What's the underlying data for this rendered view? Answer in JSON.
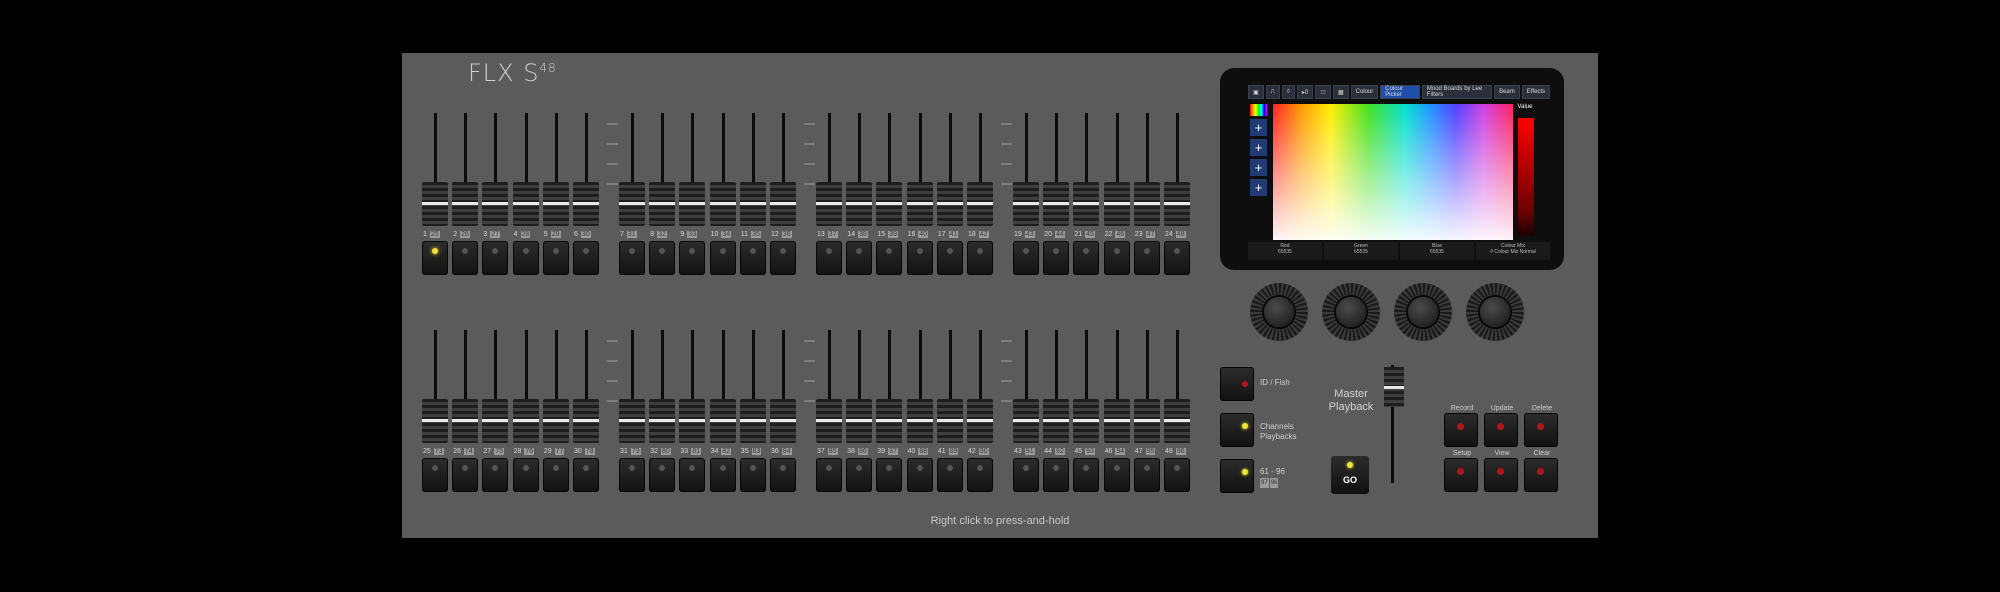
{
  "brand": {
    "name": "FLX S",
    "model_sup": "48"
  },
  "faders_top": [
    {
      "num": "1",
      "pb": "25",
      "led_on": true
    },
    {
      "num": "2",
      "pb": "26"
    },
    {
      "num": "3",
      "pb": "27"
    },
    {
      "num": "4",
      "pb": "28"
    },
    {
      "num": "5",
      "pb": "29"
    },
    {
      "num": "6",
      "pb": "30"
    },
    {
      "num": "7",
      "pb": "31"
    },
    {
      "num": "8",
      "pb": "32"
    },
    {
      "num": "9",
      "pb": "33"
    },
    {
      "num": "10",
      "pb": "34"
    },
    {
      "num": "11",
      "pb": "35"
    },
    {
      "num": "12",
      "pb": "36"
    },
    {
      "num": "13",
      "pb": "37"
    },
    {
      "num": "14",
      "pb": "38"
    },
    {
      "num": "15",
      "pb": "39"
    },
    {
      "num": "16",
      "pb": "40"
    },
    {
      "num": "17",
      "pb": "41"
    },
    {
      "num": "18",
      "pb": "42"
    },
    {
      "num": "19",
      "pb": "43"
    },
    {
      "num": "20",
      "pb": "44"
    },
    {
      "num": "21",
      "pb": "45"
    },
    {
      "num": "22",
      "pb": "46"
    },
    {
      "num": "23",
      "pb": "47"
    },
    {
      "num": "24",
      "pb": "48"
    }
  ],
  "faders_bottom": [
    {
      "num": "25",
      "pb": "73"
    },
    {
      "num": "26",
      "pb": "74"
    },
    {
      "num": "27",
      "pb": "75"
    },
    {
      "num": "28",
      "pb": "76"
    },
    {
      "num": "29",
      "pb": "77"
    },
    {
      "num": "30",
      "pb": "78"
    },
    {
      "num": "31",
      "pb": "79"
    },
    {
      "num": "32",
      "pb": "80"
    },
    {
      "num": "33",
      "pb": "81"
    },
    {
      "num": "34",
      "pb": "82"
    },
    {
      "num": "35",
      "pb": "83"
    },
    {
      "num": "36",
      "pb": "84"
    },
    {
      "num": "37",
      "pb": "85"
    },
    {
      "num": "38",
      "pb": "86"
    },
    {
      "num": "39",
      "pb": "87"
    },
    {
      "num": "40",
      "pb": "88"
    },
    {
      "num": "41",
      "pb": "89"
    },
    {
      "num": "42",
      "pb": "90"
    },
    {
      "num": "43",
      "pb": "91"
    },
    {
      "num": "44",
      "pb": "92"
    },
    {
      "num": "45",
      "pb": "93"
    },
    {
      "num": "46",
      "pb": "94"
    },
    {
      "num": "47",
      "pb": "95"
    },
    {
      "num": "48",
      "pb": "96"
    }
  ],
  "screen": {
    "tabs": [
      {
        "label": "▣",
        "icon": "intensity-icon"
      },
      {
        "label": "⎍",
        "icon": "position-icon"
      },
      {
        "label": "◊",
        "icon": "gobo-icon"
      },
      {
        "label": "▸0",
        "icon": "beam-icon"
      },
      {
        "label": "⁝⁝⁝",
        "icon": "grid-icon"
      },
      {
        "label": "▦",
        "icon": "palette-icon"
      },
      {
        "label": "Colour"
      },
      {
        "label": "Colour Picker",
        "selected": true
      },
      {
        "label": "Mood Boards by Lee Filters"
      },
      {
        "label": "Beam"
      },
      {
        "label": "Effects"
      }
    ],
    "value_label": "Value",
    "readouts": [
      {
        "name": "Red",
        "value": "65535"
      },
      {
        "name": "Green",
        "value": "65535"
      },
      {
        "name": "Blue",
        "value": "65535"
      },
      {
        "name": "Colour Mix",
        "value": "# Colour Mix Normal"
      }
    ],
    "tools": [
      "+",
      "+",
      "+",
      "+"
    ]
  },
  "controls": {
    "ui_fish_label": "ID / Fish",
    "channels_label_1": "Channels",
    "channels_label_2": "Playbacks",
    "page_label": "61 - 96",
    "page_mini_1": "97",
    "page_mini_2": "96",
    "master_label": "Master Playback",
    "go_label": "GO",
    "record_label": "Record",
    "update_label": "Update",
    "delete_label": "Delete",
    "setup_label": "Setup",
    "view_label": "View",
    "clear_label": "Clear"
  },
  "hint": "Right click to press-and-hold"
}
